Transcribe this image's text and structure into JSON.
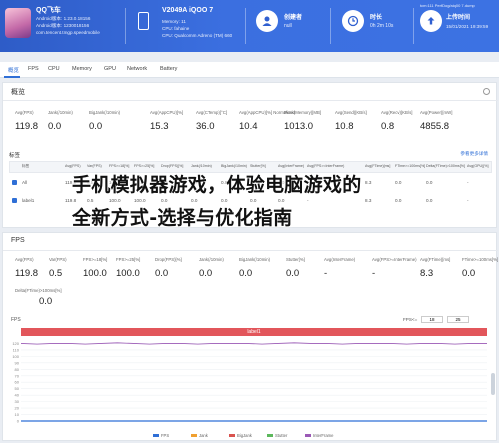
{
  "header": {
    "app_name": "QQ飞车",
    "app_lines": [
      "Android版本: 1.23.0.18156",
      "Android版本: 1230018156",
      "com.tencent.tmgp.speedmobile"
    ],
    "device_name": "V2049A iQOO 7",
    "device_lines": [
      "Memory: 11",
      "CPU: Qualcomm Adreno (TM) 660"
    ],
    "creator_label": "创建者",
    "creator_value": "null",
    "duration_label": "时长",
    "duration_value": "0h 2m 10s",
    "upload_label": "上传时间",
    "upload_value": "15/01/2021 19:39:59",
    "file_name": "tcm:111 PerfDog/aiq00 7.dump"
  },
  "tabs": [
    "概览",
    "FPS",
    "CPU",
    "Memory",
    "GPU",
    "Network",
    "Battery"
  ],
  "overview": {
    "title": "概览",
    "metrics": [
      {
        "label": "Avg(FPS)",
        "value": "119.8"
      },
      {
        "label": "Jank(/10min)",
        "value": "0.0"
      },
      {
        "label": "BigJank(/10min)",
        "value": "0.0"
      },
      {
        "label": "Avg(AppCPU)[%]",
        "value": "15.3"
      },
      {
        "label": "Avg(CTemp)[°C]",
        "value": "36.0"
      },
      {
        "label": "Avg(AppCPU)[%] Normalized",
        "value": "10.4"
      },
      {
        "label": "Peak(Memory)[MB]",
        "value": "1013.0"
      },
      {
        "label": "Avg(Send)[KB/s]",
        "value": "10.8"
      },
      {
        "label": "Avg(Recv)[KB/s]",
        "value": "0.8"
      },
      {
        "label": "Avg(Power)[mW]",
        "value": "4855.8"
      }
    ],
    "label_title": "标签",
    "label_action": "参看更多详情",
    "table_headers": [
      "标签",
      "Avg(FPS)",
      "Var(FPS)",
      "FPS>=18[%]",
      "FPS>=25[%]",
      "Drop(FPS)[%]",
      "Jank(/10min)",
      "BigJank(/10min)",
      "Stutter[%]",
      "Avg(InterFrame)",
      "Avg(FPS>=InterFrame)",
      "Avg(FTime)[ms]",
      "FTime>=100ms[%]",
      "Delta(FTime)>100ms[%]",
      "Avg(GPU)[%]"
    ],
    "rows": [
      {
        "name": "All",
        "cells": [
          "119.8",
          "0.5",
          "100.0",
          "100.0",
          "0.0",
          "0.0",
          "0.0",
          "0.0",
          "0.0",
          "-",
          "8.3",
          "0.0",
          "0.0",
          "-"
        ]
      },
      {
        "name": "label1",
        "cells": [
          "119.8",
          "0.5",
          "100.0",
          "100.0",
          "0.0",
          "0.0",
          "0.0",
          "0.0",
          "0.0",
          "-",
          "8.3",
          "0.0",
          "0.0",
          "-"
        ]
      }
    ]
  },
  "fps_panel": {
    "title": "FPS",
    "metrics": [
      {
        "label": "Avg(FPS)",
        "value": "119.8"
      },
      {
        "label": "Var(FPS)",
        "value": "0.5"
      },
      {
        "label": "FPS>=18[%]",
        "value": "100.0"
      },
      {
        "label": "FPS>=25[%]",
        "value": "100.0"
      },
      {
        "label": "Drop(FPS)[%]",
        "value": "0.0"
      },
      {
        "label": "Jank(/10min)",
        "value": "0.0"
      },
      {
        "label": "BigJank(/10min)",
        "value": "0.0"
      },
      {
        "label": "Stutter[%]",
        "value": "0.0"
      },
      {
        "label": "Avg(InterFrame)",
        "value": "-"
      },
      {
        "label": "Avg(FPS>=InterFrame)",
        "value": "-"
      },
      {
        "label": "Avg(FTime)[ms]",
        "value": "8.3"
      },
      {
        "label": "FTime>=100ms[%]",
        "value": "0.0"
      }
    ],
    "delta_label": "Delta(FTime)>100ms[%]",
    "delta_value": "0.0"
  },
  "overlay_title_line1": "手机模拟器游戏，体验电脑游戏的",
  "overlay_title_line2": "全新方式-选择与优化指南",
  "chart_data": {
    "type": "line",
    "title": "FPS",
    "band_label": "label1",
    "filter_label": "FPS<=",
    "filter_values": [
      "18",
      "25"
    ],
    "ylim": [
      0,
      130
    ],
    "yticks": [
      0,
      10,
      20,
      30,
      40,
      50,
      60,
      70,
      80,
      90,
      100,
      110,
      120
    ],
    "series": [
      {
        "name": "FPS",
        "color": "#9b59b6",
        "values": [
          120,
          119,
          120,
          120,
          119,
          120,
          121,
          120,
          119,
          120,
          120,
          119,
          120,
          120,
          120,
          119,
          120,
          121,
          120,
          120,
          119,
          120,
          120,
          120,
          119,
          120,
          120,
          119,
          120,
          120
        ]
      }
    ],
    "legend": [
      "FPS",
      "Jank",
      "BigJank",
      "Stutter",
      "InterFrame"
    ],
    "legend_colors": [
      "#2f6fd6",
      "#f0a030",
      "#d9534f",
      "#5cb85c",
      "#9b59b6"
    ]
  }
}
